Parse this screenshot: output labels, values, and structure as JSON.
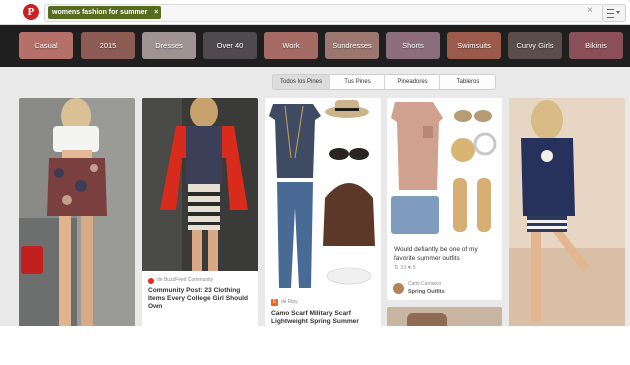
{
  "header": {
    "logo_letter": "P",
    "search_chip": "womens fashion for summer",
    "chip_remove": "×",
    "clear": "×"
  },
  "guides": [
    {
      "label": "Casual",
      "color": "#b5706a"
    },
    {
      "label": "2015",
      "color": "#8b5b54"
    },
    {
      "label": "Dresses",
      "color": "#9f9394"
    },
    {
      "label": "Over 40",
      "color": "#4f4a4e"
    },
    {
      "label": "Work",
      "color": "#a56a63"
    },
    {
      "label": "Sundresses",
      "color": "#9c776f"
    },
    {
      "label": "Shorts",
      "color": "#8b6e7a"
    },
    {
      "label": "Swimsuits",
      "color": "#9b5a4a"
    },
    {
      "label": "Curvy Girls",
      "color": "#5b4e4a"
    },
    {
      "label": "Bikinis",
      "color": "#8b4f57"
    }
  ],
  "filters": {
    "all": "Todos los Pines",
    "yours": "Tus Pines",
    "pinners": "Pineadores",
    "boards": "Tableros"
  },
  "pins": {
    "pin2": {
      "source": "de BuzzFeed Community",
      "title": "Community Post: 23 Clothing Items Every College Girl Should Own"
    },
    "pin3": {
      "source_letter": "E",
      "source": "de Etsy",
      "title": "Camo Scarf Military Scarf Lightweight Spring Summer"
    },
    "pin4": {
      "description": "Would defiantly be one of my favorite summer outfits",
      "repins": "33",
      "likes": "5",
      "pinner": "Cami Carrasco",
      "board": "Spring Outfits"
    }
  },
  "colors": {
    "pinterest_red": "#cb2027",
    "chip_green": "#566d20"
  }
}
